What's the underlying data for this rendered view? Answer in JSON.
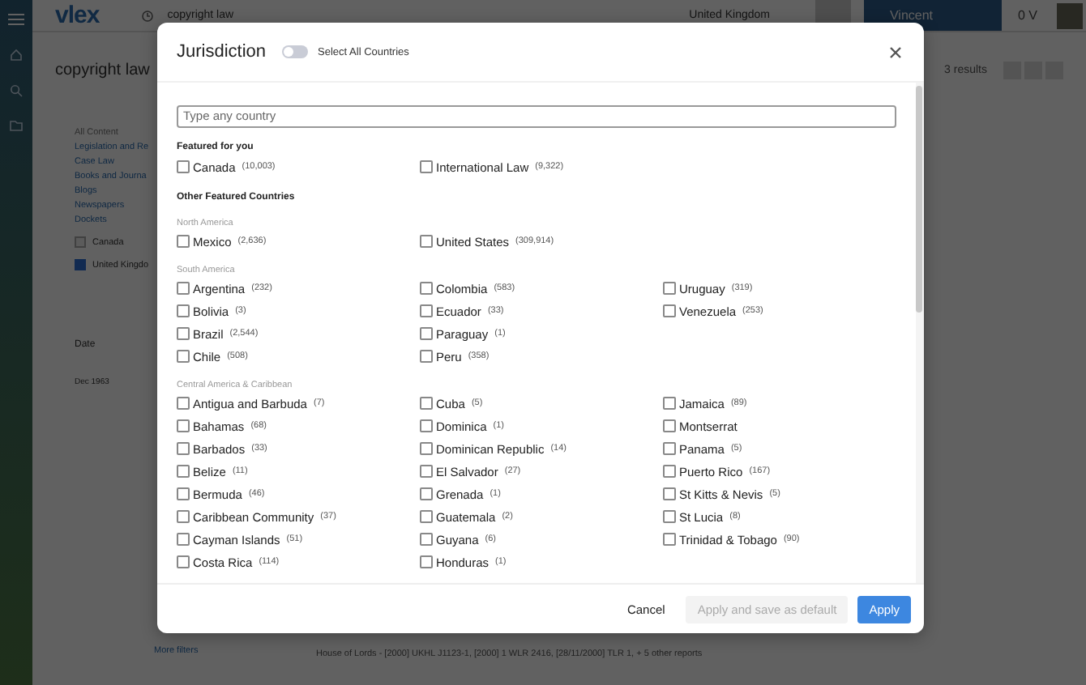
{
  "app": {
    "logo": "vlex",
    "search_query": "copyright law",
    "region": "United Kingdom",
    "user_name": "Vincent",
    "credits": "0 V"
  },
  "page": {
    "title": "copyright law",
    "results": "3 results",
    "filters": [
      {
        "label": "All Content",
        "kind": "heading"
      },
      {
        "label": "Legislation and Re",
        "kind": "link"
      },
      {
        "label": "Case Law",
        "kind": "link"
      },
      {
        "label": "Books and Journa",
        "kind": "link"
      },
      {
        "label": "Blogs",
        "kind": "link"
      },
      {
        "label": "Newspapers",
        "kind": "link"
      },
      {
        "label": "Dockets",
        "kind": "link"
      }
    ],
    "countries": [
      {
        "label": "Canada",
        "checked": false
      },
      {
        "label": "United Kingdo",
        "checked": true
      }
    ],
    "date_label": "Date",
    "date_start": "Dec 1963",
    "more_filters": "More filters",
    "citation": "House of Lords -  [2000] UKHL J1123-1,  [2000] 1 WLR 2416,  [28/11/2000] TLR 1,  + 5 other reports"
  },
  "dialog": {
    "title": "Jurisdiction",
    "select_all": {
      "label": "Select All Countries",
      "on": false
    },
    "search": {
      "placeholder": "Type any country"
    },
    "featured": {
      "title": "Featured for you",
      "items": [
        {
          "name": "Canada",
          "count": "(10,003)",
          "checked": false
        },
        {
          "name": "International Law",
          "count": "(9,322)",
          "checked": false
        }
      ]
    },
    "other": {
      "title": "Other Featured Countries",
      "groups": [
        {
          "title": "North America",
          "items": [
            {
              "name": "Mexico",
              "count": "(2,636)",
              "checked": false
            },
            {
              "name": "United States",
              "count": "(309,914)",
              "checked": false
            }
          ]
        },
        {
          "title": "South America",
          "items": [
            {
              "name": "Argentina",
              "count": "(232)",
              "checked": false
            },
            {
              "name": "Bolivia",
              "count": "(3)",
              "checked": false
            },
            {
              "name": "Brazil",
              "count": "(2,544)",
              "checked": false
            },
            {
              "name": "Chile",
              "count": "(508)",
              "checked": false
            },
            {
              "name": "Colombia",
              "count": "(583)",
              "checked": false
            },
            {
              "name": "Ecuador",
              "count": "(33)",
              "checked": false
            },
            {
              "name": "Paraguay",
              "count": "(1)",
              "checked": false
            },
            {
              "name": "Peru",
              "count": "(358)",
              "checked": false
            },
            {
              "name": "Uruguay",
              "count": "(319)",
              "checked": false
            },
            {
              "name": "Venezuela",
              "count": "(253)",
              "checked": false
            }
          ]
        },
        {
          "title": "Central America & Caribbean",
          "items": [
            {
              "name": "Antigua and Barbuda",
              "count": "(7)",
              "checked": false
            },
            {
              "name": "Bahamas",
              "count": "(68)",
              "checked": false
            },
            {
              "name": "Barbados",
              "count": "(33)",
              "checked": false
            },
            {
              "name": "Belize",
              "count": "(11)",
              "checked": false
            },
            {
              "name": "Bermuda",
              "count": "(46)",
              "checked": false
            },
            {
              "name": "Caribbean Community",
              "count": "(37)",
              "checked": false
            },
            {
              "name": "Cayman Islands",
              "count": "(51)",
              "checked": false
            },
            {
              "name": "Costa Rica",
              "count": "(114)",
              "checked": false
            },
            {
              "name": "Cuba",
              "count": "(5)",
              "checked": false
            },
            {
              "name": "Dominica",
              "count": "(1)",
              "checked": false
            },
            {
              "name": "Dominican Republic",
              "count": "(14)",
              "checked": false
            },
            {
              "name": "El Salvador",
              "count": "(27)",
              "checked": false
            },
            {
              "name": "Grenada",
              "count": "(1)",
              "checked": false
            },
            {
              "name": "Guatemala",
              "count": "(2)",
              "checked": false
            },
            {
              "name": "Guyana",
              "count": "(6)",
              "checked": false
            },
            {
              "name": "Honduras",
              "count": "(1)",
              "checked": false
            },
            {
              "name": "Jamaica",
              "count": "(89)",
              "checked": false
            },
            {
              "name": "Montserrat",
              "checked": false
            },
            {
              "name": "Panama",
              "count": "(5)",
              "checked": false
            },
            {
              "name": "Puerto Rico",
              "count": "(167)",
              "checked": false
            },
            {
              "name": "St Kitts & Nevis",
              "count": "(5)",
              "checked": false
            },
            {
              "name": "St Lucia",
              "count": "(8)",
              "checked": false
            },
            {
              "name": "Trinidad & Tobago",
              "count": "(90)",
              "checked": false
            }
          ]
        }
      ]
    },
    "buttons": [
      {
        "label": "Cancel",
        "kind": "text"
      },
      {
        "label": "Apply and save as default",
        "kind": "disabled"
      },
      {
        "label": "Apply",
        "kind": "primary"
      }
    ]
  }
}
